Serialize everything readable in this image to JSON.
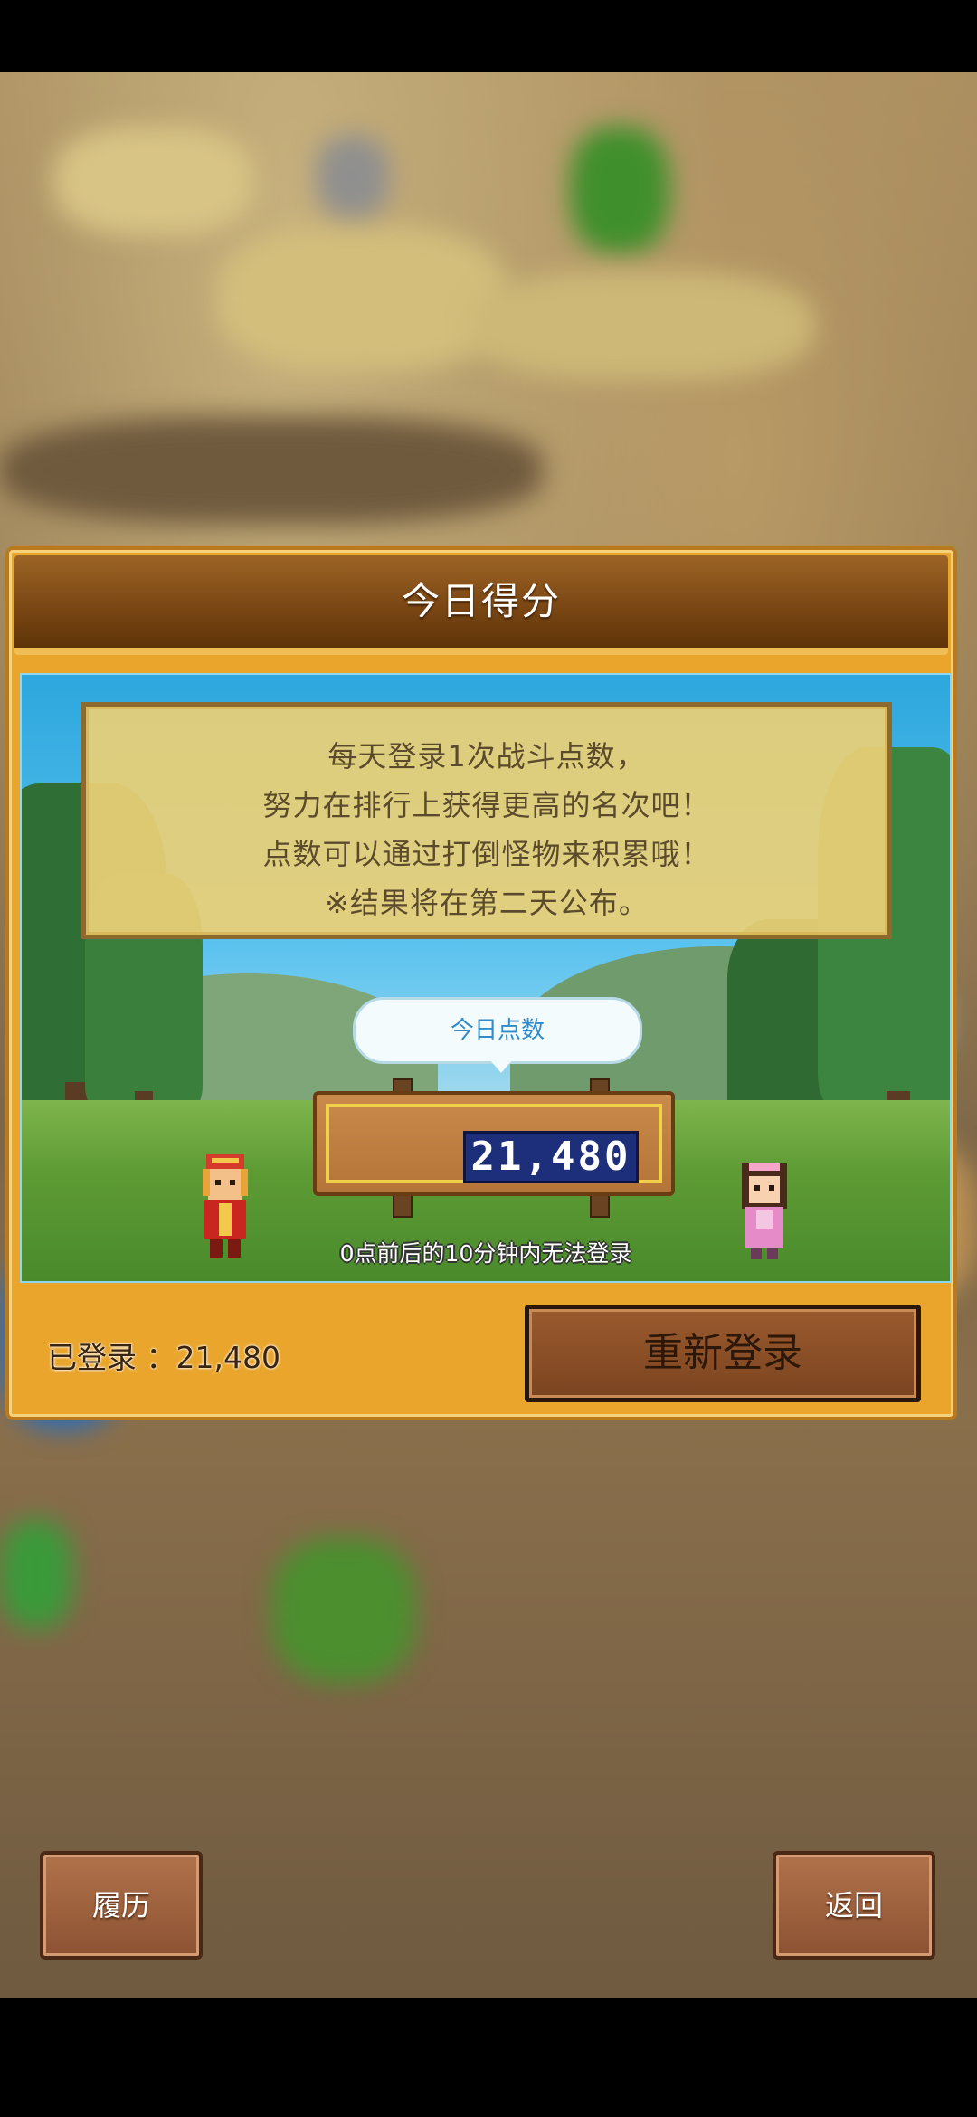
{
  "dialog": {
    "title": "今日得分",
    "info_lines": [
      "每天登录1次战斗点数，",
      "努力在排行上获得更高的名次吧！",
      "点数可以通过打倒怪物来积累哦！",
      "※结果将在第二天公布。"
    ],
    "speech_label": "今日点数",
    "today_score": "21,480",
    "notice": "0点前后的10分钟内无法登录",
    "logged_label": "已登录 ：21,480",
    "relogin_button": "重新登录"
  },
  "footer": {
    "history_button": "履历",
    "back_button": "返回"
  },
  "colors": {
    "dialog_bg": "#e9a52c",
    "header_bg": "#7b4714",
    "score_box": "#1d2f7a",
    "speech_text": "#2f8bc9"
  }
}
